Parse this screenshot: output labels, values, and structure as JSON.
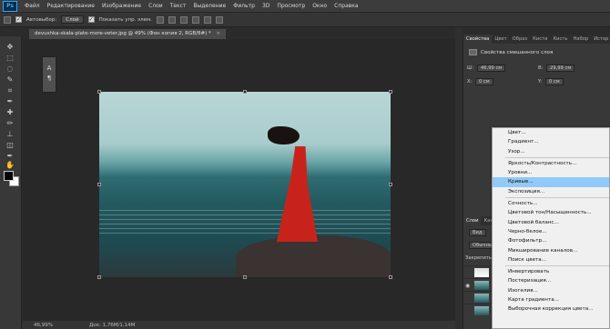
{
  "app": {
    "logo": "Ps"
  },
  "menubar": [
    "Файл",
    "Редактирование",
    "Изображение",
    "Слои",
    "Текст",
    "Выделение",
    "Фильтр",
    "3D",
    "Просмотр",
    "Окно",
    "Справка"
  ],
  "options": {
    "auto_select_label": "Автовыбор:",
    "auto_select_value": "Слой",
    "show_transform_label": "Показать упр. элем."
  },
  "document": {
    "tab_title": "devushka-skala-plate-more-veter.jpg @ 49% (Фон копия 2, RGB/8#) *",
    "close": "×"
  },
  "minipanel": {
    "text_icon": "A",
    "para_icon": "¶"
  },
  "status": {
    "zoom": "46,99%",
    "doc": "Док: 1,76M/1,14M"
  },
  "properties": {
    "tabs": [
      "Свойства",
      "Цвет",
      "Образ",
      "Кисти",
      "Кисть",
      "Набор",
      "Истор"
    ],
    "title": "Свойства смешанного слоя",
    "w_label": "Ш:",
    "w_value": "46,99 см",
    "h_label": "В:",
    "h_value": "29,99 см",
    "x_label": "X:",
    "x_value": "0 см",
    "y_label": "Y:",
    "y_value": "0 см"
  },
  "layers": {
    "tabs": [
      "Слои",
      "Кана"
    ],
    "kind_label": "Вид",
    "blend_label": "Обычные",
    "lock_label": "Закрепить:"
  },
  "context_menu": {
    "items": [
      {
        "label": "Цвет...",
        "selected": false,
        "sep_after": false
      },
      {
        "label": "Градиент...",
        "selected": false,
        "sep_after": false
      },
      {
        "label": "Узор...",
        "selected": false,
        "sep_after": true
      },
      {
        "label": "Яркость/Контрастность...",
        "selected": false,
        "sep_after": false
      },
      {
        "label": "Уровни...",
        "selected": false,
        "sep_after": false
      },
      {
        "label": "Кривые...",
        "selected": true,
        "sep_after": false
      },
      {
        "label": "Экспозиция...",
        "selected": false,
        "sep_after": true
      },
      {
        "label": "Сочность...",
        "selected": false,
        "sep_after": false
      },
      {
        "label": "Цветовой тон/Насыщенность...",
        "selected": false,
        "sep_after": false
      },
      {
        "label": "Цветовой баланс...",
        "selected": false,
        "sep_after": false
      },
      {
        "label": "Черно-белое...",
        "selected": false,
        "sep_after": false
      },
      {
        "label": "Фотофильтр...",
        "selected": false,
        "sep_after": false
      },
      {
        "label": "Микширование каналов...",
        "selected": false,
        "sep_after": false
      },
      {
        "label": "Поиск цвета...",
        "selected": false,
        "sep_after": true
      },
      {
        "label": "Инвертировать",
        "selected": false,
        "sep_after": false
      },
      {
        "label": "Постеризация...",
        "selected": false,
        "sep_after": false
      },
      {
        "label": "Изогелия...",
        "selected": false,
        "sep_after": false
      },
      {
        "label": "Карта градиента...",
        "selected": false,
        "sep_after": false
      },
      {
        "label": "Выборочная коррекция цвета...",
        "selected": false,
        "sep_after": false
      }
    ]
  },
  "colors": {
    "selection": "#91c9f7",
    "foreground": "#000000",
    "background": "#ffffff"
  }
}
